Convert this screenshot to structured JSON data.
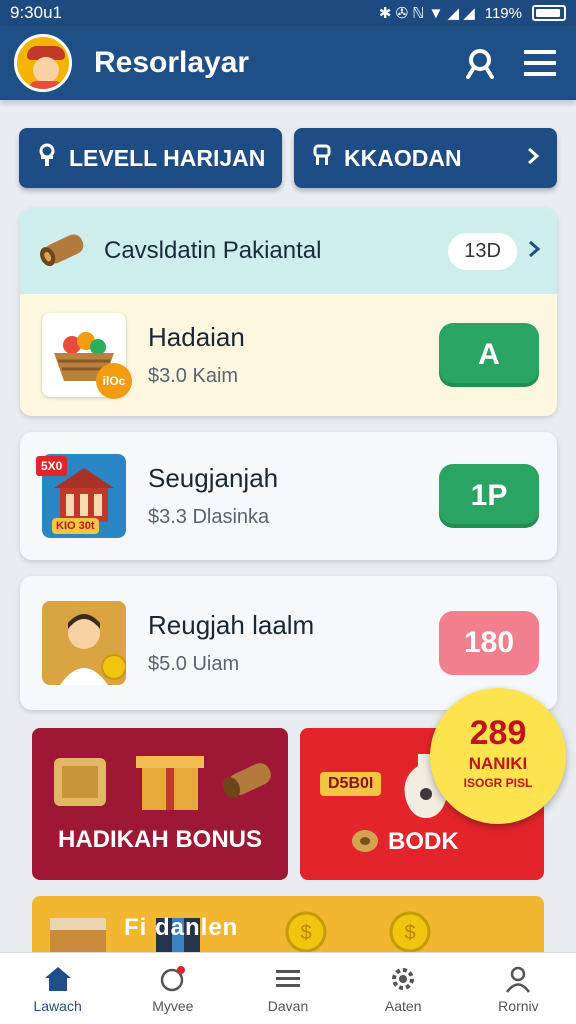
{
  "status_bar": {
    "time": "9:30u1",
    "icons": "✱ ✇ ℕ ▼ ◢ ◢",
    "battery_text": "119%"
  },
  "app_bar": {
    "title": "Resorlayar"
  },
  "nav": {
    "daily_label": "LEVELL HARIJAN",
    "second_label": "KKAODAN"
  },
  "section": {
    "title": "Cavsldatin Pakiantal",
    "badge": "13D"
  },
  "items": [
    {
      "name": "Hadaian",
      "price": "$3.0 Kaim",
      "thumb_tag": "ilOc",
      "action_label": "A"
    },
    {
      "name": "Seugjanjah",
      "price": "$3.3 Dlasinka",
      "thumb_tag": "5X0",
      "thumb_sub": "KIO 30t",
      "action_label": "1P"
    },
    {
      "name": "Reugjah laalm",
      "price": "$5.0 Uiam",
      "action_label": "180"
    }
  ],
  "promos": {
    "left_label": "HADIKAH BONUS",
    "right_tag": "D5B0I",
    "right_label": "BODK",
    "bottom_text": "Fi   danlen"
  },
  "burst": {
    "number": "289",
    "line1": "NANIKI",
    "line2": "ISOGR PISL"
  },
  "tabs": [
    {
      "label": "Lawach"
    },
    {
      "label": "Myvee"
    },
    {
      "label": "Davan"
    },
    {
      "label": "Aaten"
    },
    {
      "label": "Rorniv"
    }
  ],
  "colors": {
    "primary": "#1f4f87",
    "accent_green": "#2aa463",
    "promo_red": "#9e1835",
    "promo_bright_red": "#e3252b",
    "burst_yellow": "#fde34d"
  }
}
